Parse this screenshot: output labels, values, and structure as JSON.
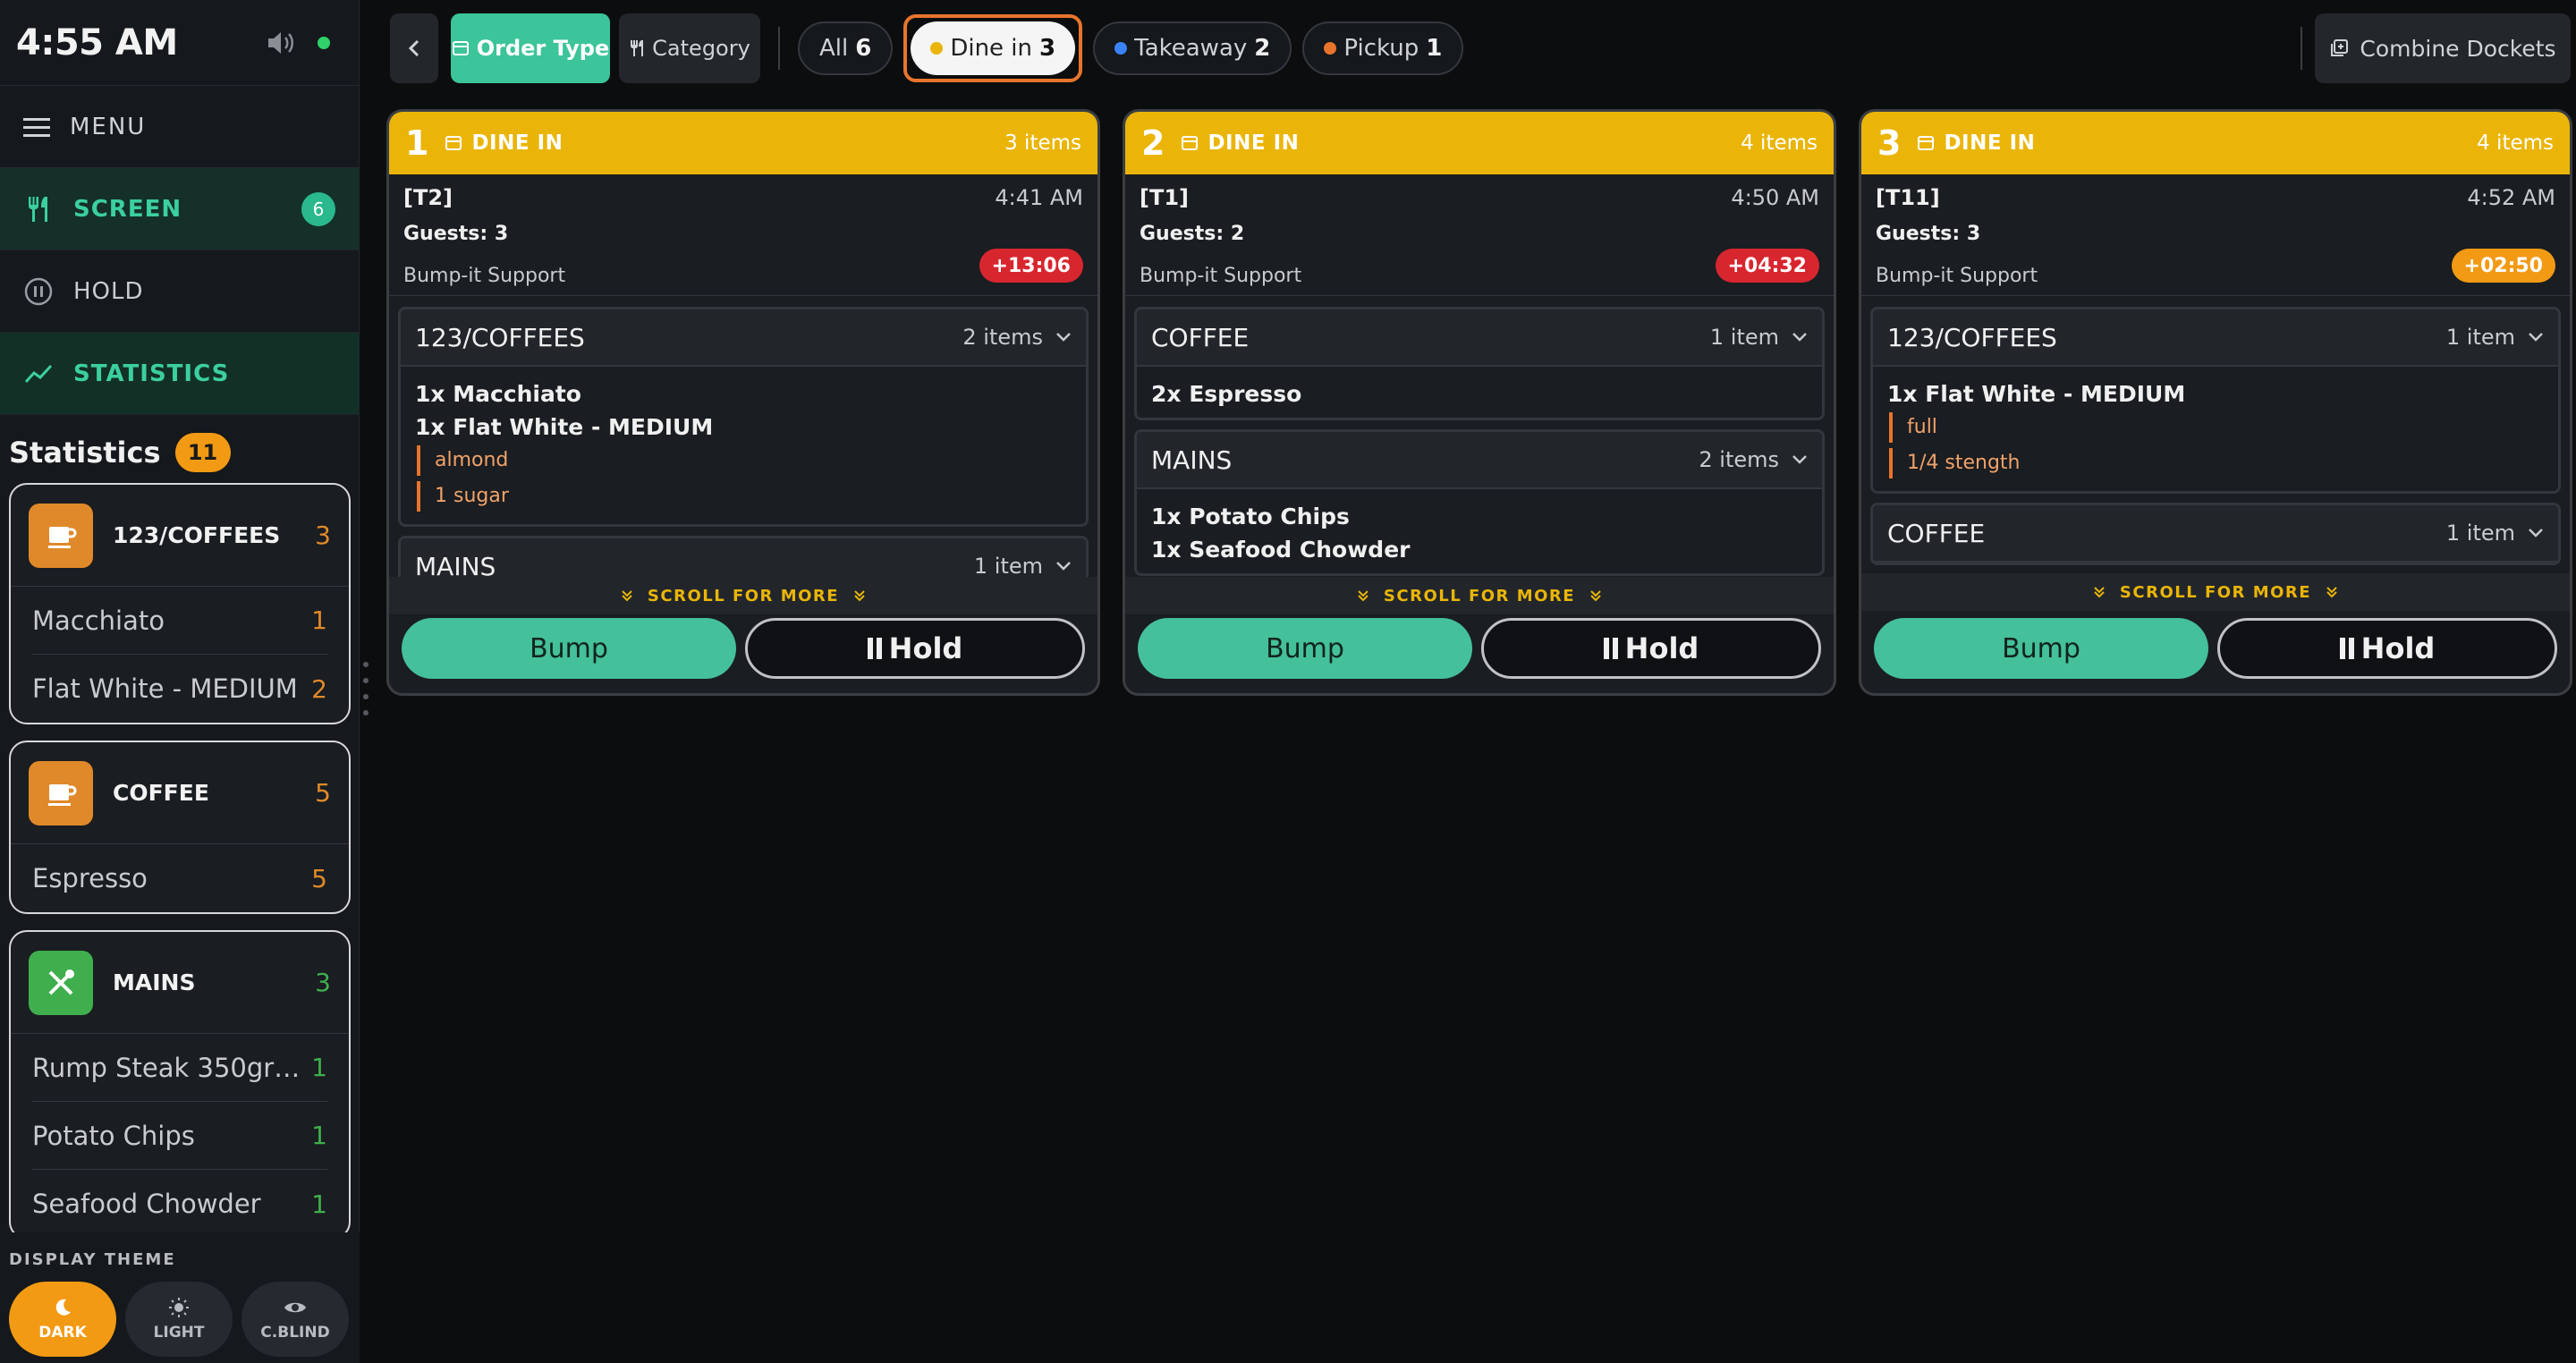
{
  "sidebar": {
    "clock": "4:55 AM",
    "menu_label": "MENU",
    "nav": [
      {
        "label": "SCREEN",
        "badge": "6"
      },
      {
        "label": "HOLD"
      },
      {
        "label": "STATISTICS"
      }
    ],
    "stats_title": "Statistics",
    "stats_count": "11",
    "stat_cards": [
      {
        "name": "123/COFFEES",
        "count": "3",
        "icon": "coffee-icon",
        "color": "#e0892a",
        "items": [
          {
            "name": "Macchiato",
            "count": "1"
          },
          {
            "name": "Flat White - MEDIUM",
            "count": "2"
          }
        ]
      },
      {
        "name": "COFFEE",
        "count": "5",
        "icon": "coffee-icon",
        "color": "#e0892a",
        "items": [
          {
            "name": "Espresso",
            "count": "5"
          }
        ]
      },
      {
        "name": "MAINS",
        "count": "3",
        "icon": "utensils-icon",
        "color": "#3fae4d",
        "items": [
          {
            "name": "Rump Steak 350gr -...",
            "count": "1"
          },
          {
            "name": "Potato Chips",
            "count": "1"
          },
          {
            "name": "Seafood Chowder",
            "count": "1"
          }
        ]
      }
    ],
    "theme_label": "DISPLAY THEME",
    "themes": [
      {
        "label": "DARK"
      },
      {
        "label": "LIGHT"
      },
      {
        "label": "C.BLIND"
      }
    ]
  },
  "topbar": {
    "order_type": "Order Type",
    "category": "Category",
    "filters": [
      {
        "label": "All",
        "count": "6"
      },
      {
        "label": "Dine in",
        "count": "3",
        "dot": "#eab508"
      },
      {
        "label": "Takeaway",
        "count": "2",
        "dot": "#3b82f6"
      },
      {
        "label": "Pickup",
        "count": "1",
        "dot": "#e8742c"
      }
    ],
    "combine": "Combine Dockets"
  },
  "dockets": [
    {
      "num": "1",
      "type": "DINE IN",
      "items_count": "3 items",
      "table": "[T2]",
      "time": "4:41 AM",
      "guests_label": "Guests:",
      "guests": "3",
      "support": "Bump-it Support",
      "timer": "+13:06",
      "timer_color": "#d8262f",
      "groups": [
        {
          "name": "123/COFFEES",
          "count": "2 items",
          "items": [
            {
              "text": "1x Macchiato",
              "mods": []
            },
            {
              "text": "1x Flat White - MEDIUM",
              "mods": [
                "almond",
                "1 sugar"
              ]
            }
          ]
        },
        {
          "name": "MAINS",
          "count": "1 item",
          "items": []
        }
      ]
    },
    {
      "num": "2",
      "type": "DINE IN",
      "items_count": "4 items",
      "table": "[T1]",
      "time": "4:50 AM",
      "guests_label": "Guests:",
      "guests": "2",
      "support": "Bump-it Support",
      "timer": "+04:32",
      "timer_color": "#d8262f",
      "groups": [
        {
          "name": "COFFEE",
          "count": "1 item",
          "items": [
            {
              "text": "2x Espresso",
              "mods": []
            }
          ]
        },
        {
          "name": "MAINS",
          "count": "2 items",
          "items": [
            {
              "text": "1x Potato Chips",
              "mods": []
            },
            {
              "text": "1x Seafood Chowder",
              "mods": []
            }
          ]
        }
      ]
    },
    {
      "num": "3",
      "type": "DINE IN",
      "items_count": "4 items",
      "table": "[T11]",
      "time": "4:52 AM",
      "guests_label": "Guests:",
      "guests": "3",
      "support": "Bump-it Support",
      "timer": "+02:50",
      "timer_color": "#f29a14",
      "groups": [
        {
          "name": "123/COFFEES",
          "count": "1 item",
          "items": [
            {
              "text": "1x Flat White - MEDIUM",
              "mods": [
                "full",
                "1/4 stength"
              ]
            }
          ]
        },
        {
          "name": "COFFEE",
          "count": "1 item",
          "items": []
        }
      ]
    }
  ],
  "scroll_more": "SCROLL FOR MORE",
  "bump_label": "Bump",
  "hold_label": "Hold"
}
